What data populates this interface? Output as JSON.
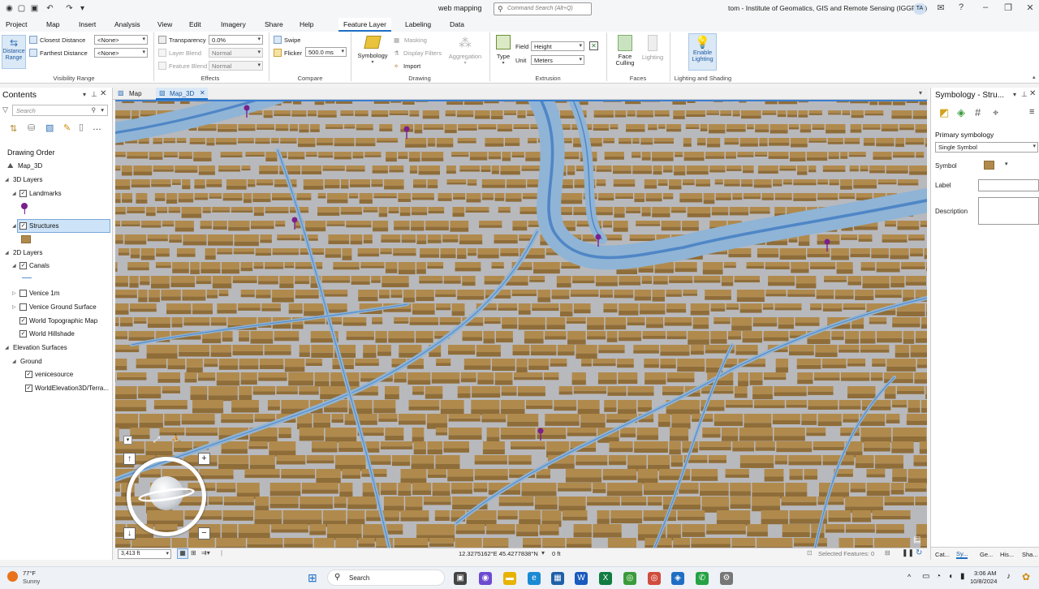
{
  "window": {
    "app_title": "web mapping",
    "command_search_placeholder": "Command Search (Alt+Q)",
    "user": "tom - Institute of Geomatics, GIS and Remote Sensing (IGGReS)",
    "avatar_initials": "TA"
  },
  "menu": {
    "tabs": [
      "Project",
      "Map",
      "Insert",
      "Analysis",
      "View",
      "Edit",
      "Imagery",
      "Share",
      "Help"
    ],
    "contextual_tabs": [
      "Feature Layer",
      "Labeling",
      "Data"
    ]
  },
  "ribbon": {
    "visibility_range": {
      "distance_range_label": "Distance Range",
      "closest_label": "Closest Distance",
      "closest_value": "<None>",
      "farthest_label": "Farthest Distance",
      "farthest_value": "<None>",
      "group_label": "Visibility Range"
    },
    "effects": {
      "transparency_label": "Transparency",
      "transparency_value": "0.0%",
      "layer_blend_label": "Layer Blend",
      "layer_blend_value": "Normal",
      "feature_blend_label": "Feature Blend",
      "feature_blend_value": "Normal",
      "group_label": "Effects"
    },
    "compare": {
      "swipe_label": "Swipe",
      "flicker_label": "Flicker",
      "flicker_value": "500.0  ms",
      "group_label": "Compare"
    },
    "drawing": {
      "symbology_label": "Symbology",
      "masking_label": "Masking",
      "display_filters_label": "Display Filters",
      "import_label": "Import",
      "aggregation_label": "Aggregation",
      "group_label": "Drawing"
    },
    "extrusion": {
      "type_label": "Type",
      "field_label": "Field",
      "field_value": "Height",
      "unit_label": "Unit",
      "unit_value": "Meters",
      "group_label": "Extrusion"
    },
    "faces": {
      "face_culling_label": "Face Culling",
      "lighting_label": "Lighting",
      "group_label": "Faces"
    },
    "lighting_shading": {
      "enable_lighting_label": "Enable Lighting",
      "group_label": "Lighting and Shading"
    }
  },
  "contents": {
    "title": "Contents",
    "search_placeholder": "Search",
    "drawing_order": "Drawing Order",
    "items": [
      {
        "label": "Map_3D",
        "checked": null
      },
      {
        "label": "3D Layers",
        "checked": null
      },
      {
        "label": "Landmarks",
        "checked": true
      },
      {
        "label": "Structures",
        "checked": true
      },
      {
        "label": "2D Layers",
        "checked": null
      },
      {
        "label": "Canals",
        "checked": true
      },
      {
        "label": "Venice 1m",
        "checked": false
      },
      {
        "label": "Venice Ground Surface",
        "checked": false
      },
      {
        "label": "World Topographic Map",
        "checked": true
      },
      {
        "label": "World Hillshade",
        "checked": true
      },
      {
        "label": "Elevation Surfaces",
        "checked": null
      },
      {
        "label": "Ground",
        "checked": null
      },
      {
        "label": "venicesource",
        "checked": true
      },
      {
        "label": "WorldElevation3D/Terra...",
        "checked": true
      }
    ]
  },
  "map_tabs": [
    {
      "label": "Map",
      "active": false
    },
    {
      "label": "Map_3D",
      "active": true
    }
  ],
  "map_status": {
    "scale": "3,413 ft",
    "coordinates": "12.3275162°E 45.4277838°N",
    "elevation": "0 ft",
    "selected_features": "Selected Features: 0"
  },
  "symbology": {
    "title": "Symbology - Stru...",
    "primary_label": "Primary symbology",
    "primary_value": "Single Symbol",
    "symbol_label": "Symbol",
    "symbol_color": "#b08a4d",
    "label_label": "Label",
    "description_label": "Description",
    "bottom_tabs": [
      "Cat...",
      "Sy...",
      "Ge...",
      "His...",
      "Sha..."
    ]
  },
  "colors": {
    "building": "#b08a4d",
    "canal": "#8fb4d6",
    "ground": "#b8b9bd",
    "landmark": "#7b1f8c",
    "accent": "#1e6fc4"
  },
  "taskbar": {
    "weather_temp": "77°F",
    "weather_desc": "Sunny",
    "search_label": "Search",
    "time": "3:06 AM",
    "date": "10/8/2024"
  }
}
